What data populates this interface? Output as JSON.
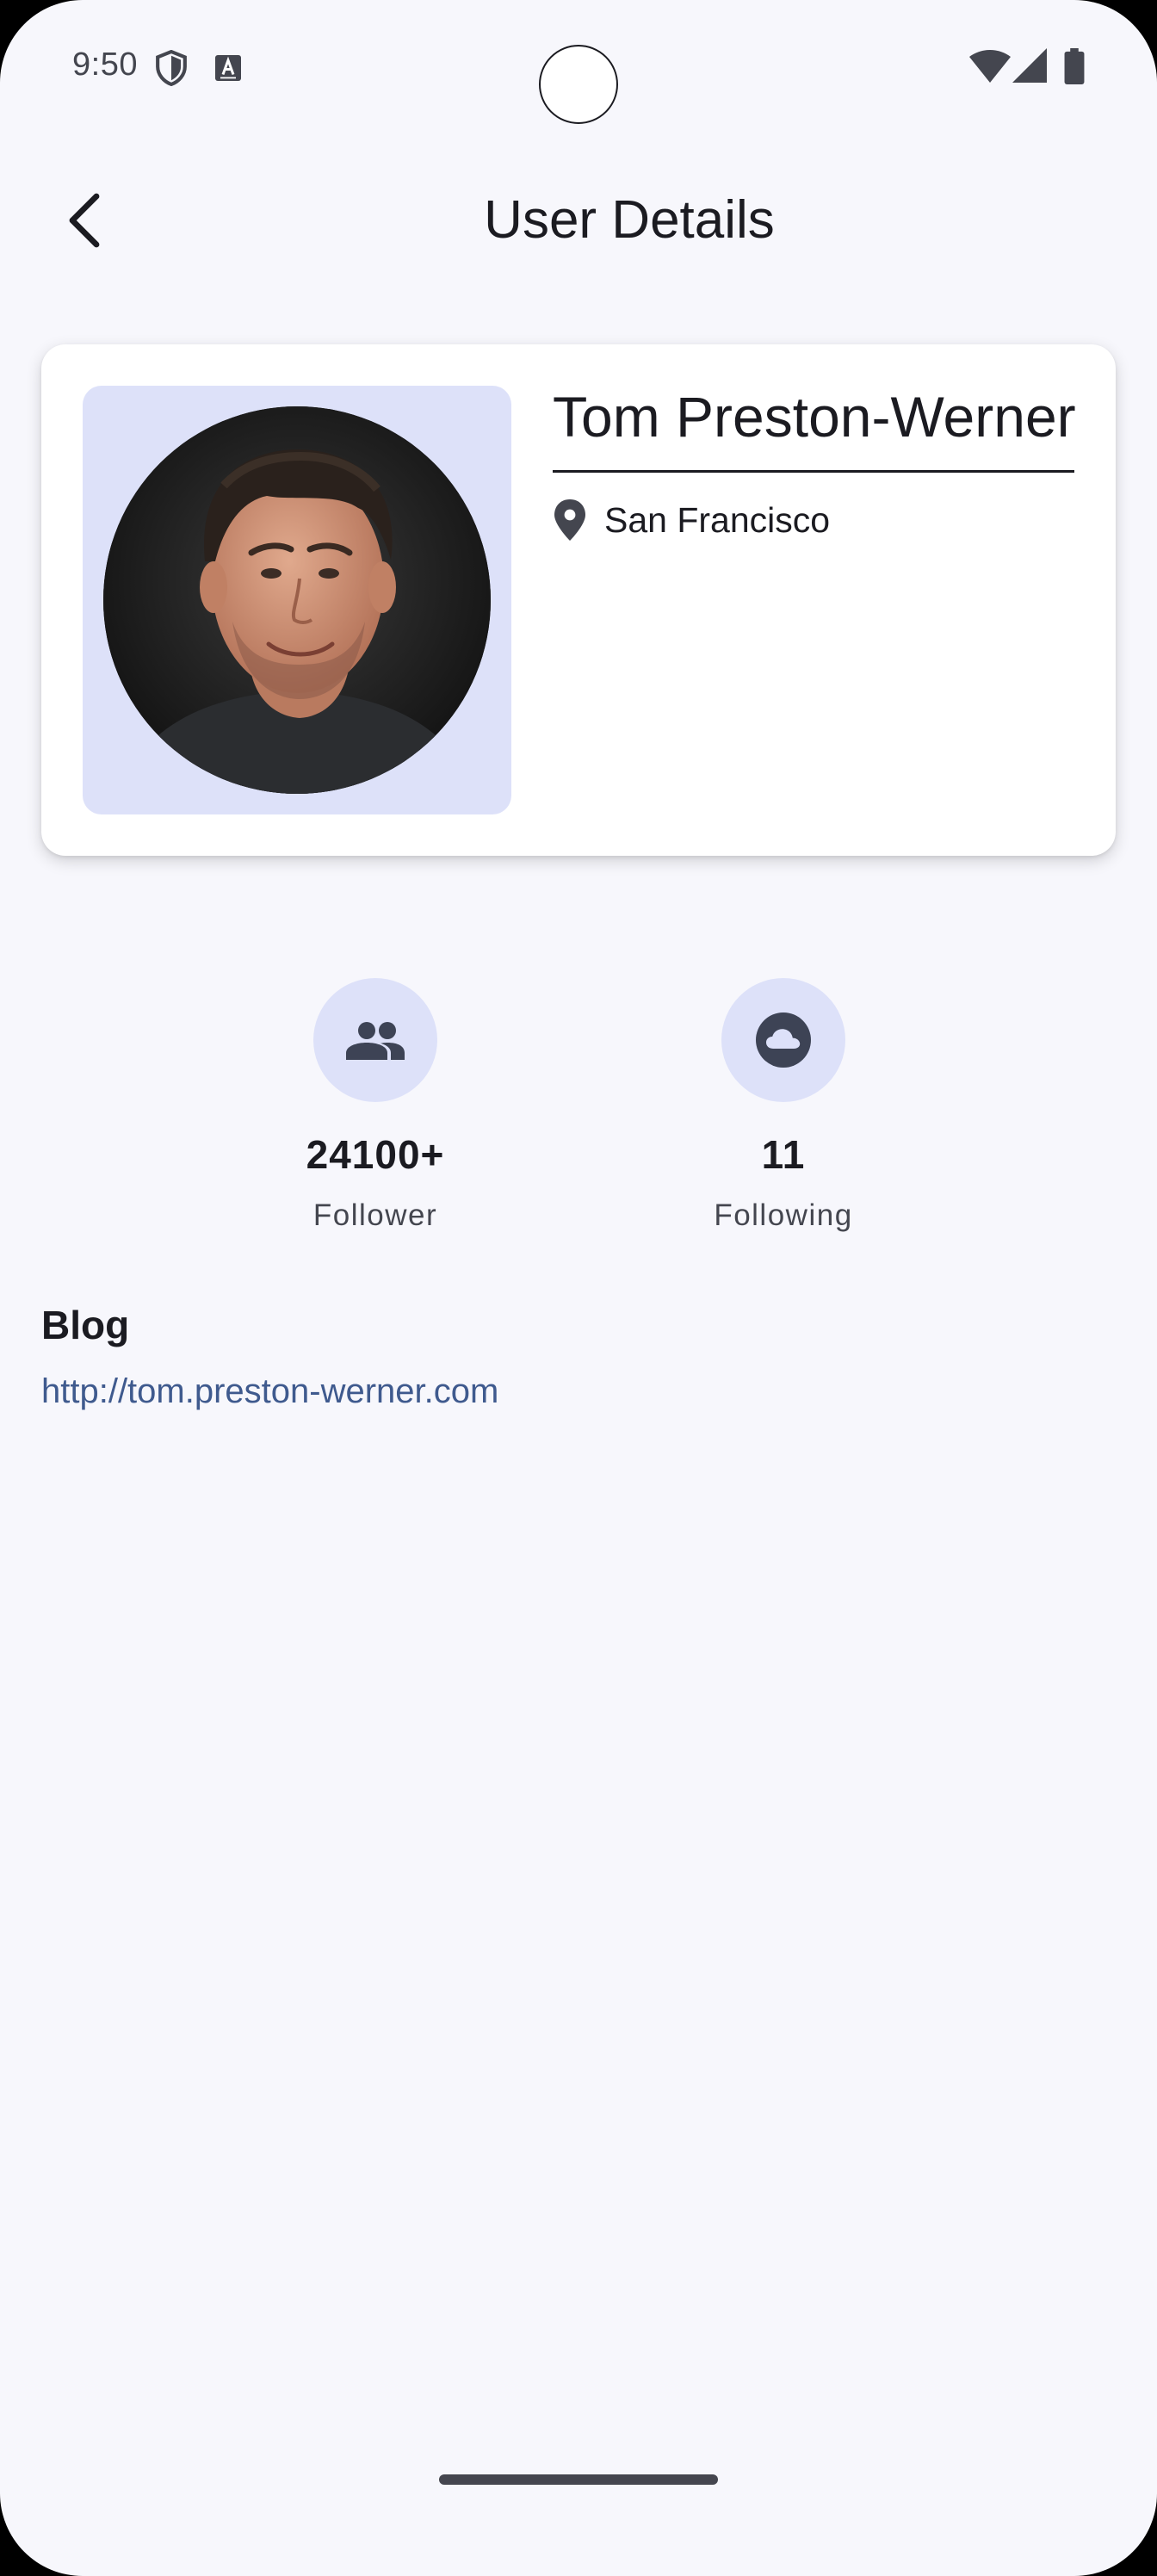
{
  "status_bar": {
    "time": "9:50",
    "icons": [
      "shield-icon",
      "keyboard-a-icon",
      "wifi-icon",
      "signal-icon",
      "battery-icon"
    ]
  },
  "app_bar": {
    "title": "User Details",
    "back_icon": "arrow-back-icon"
  },
  "profile": {
    "name": "Tom Preston-Werner",
    "location": "San Francisco",
    "location_icon": "location-pin-icon",
    "avatar_alt": "profile photo"
  },
  "stats": {
    "followers": {
      "value": "24100+",
      "label": "Follower",
      "icon": "people-icon"
    },
    "following": {
      "value": "11",
      "label": "Following",
      "icon": "cloud-icon"
    }
  },
  "blog": {
    "heading": "Blog",
    "url": "http://tom.preston-werner.com"
  },
  "colors": {
    "background": "#f7f7fc",
    "card": "#ffffff",
    "accent_container": "#dde1f9",
    "icon": "#3d4355",
    "link": "#3f5a8e",
    "text": "#1b1b21"
  }
}
